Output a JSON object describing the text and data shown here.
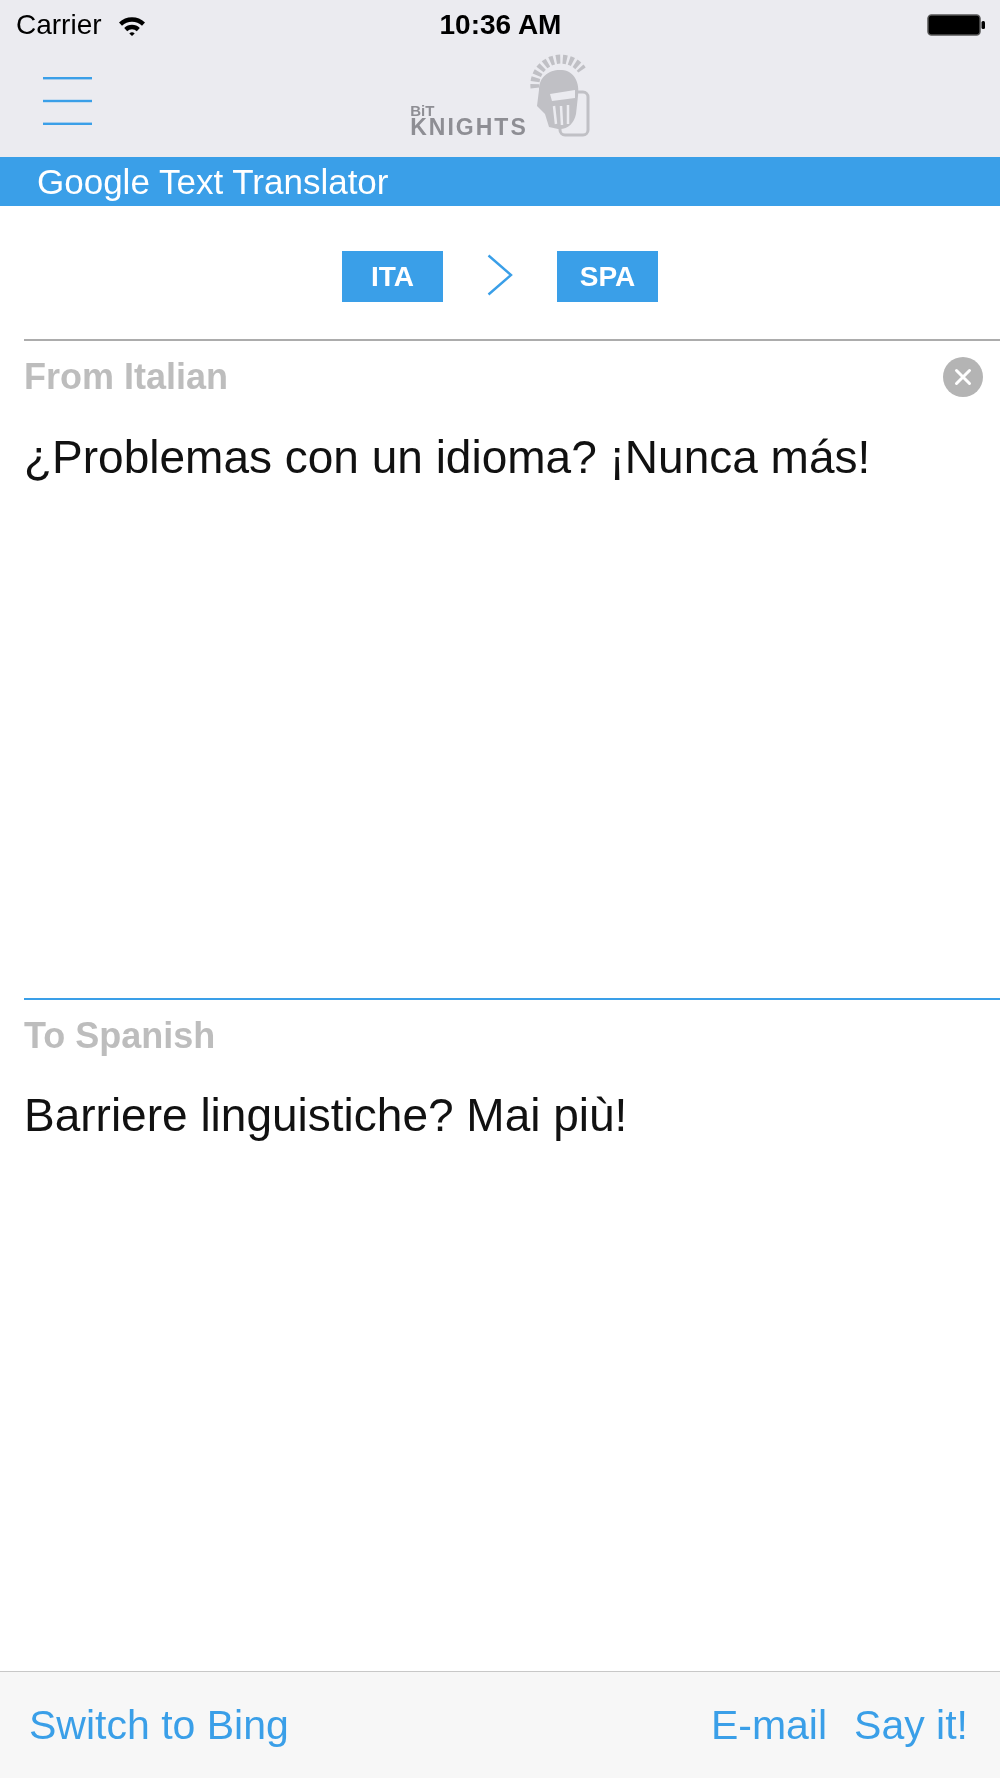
{
  "status_bar": {
    "carrier": "Carrier",
    "time": "10:36 AM"
  },
  "nav_bar": {
    "logo": {
      "small_text": "BiT",
      "large_text": "KNIGHTS"
    }
  },
  "title_bar": {
    "title": "Google Text Translator"
  },
  "language_pair": {
    "source": "ITA",
    "target": "SPA"
  },
  "source_panel": {
    "label": "From Italian",
    "text": "¿Problemas con un idioma? ¡Nunca más!"
  },
  "target_panel": {
    "label": "To Spanish",
    "text": "Barriere linguistiche? Mai più!"
  },
  "toolbar": {
    "left": [
      {
        "label": "Switch to Bing"
      }
    ],
    "right": [
      {
        "label": "E-mail"
      },
      {
        "label": "Say it!"
      }
    ]
  }
}
